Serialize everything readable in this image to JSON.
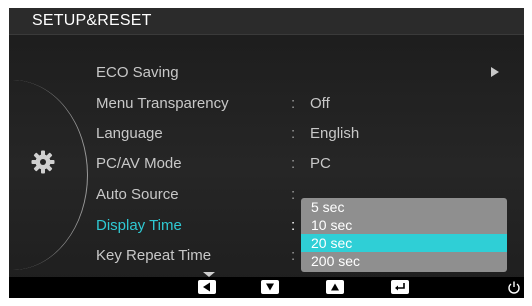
{
  "title": "SETUP&RESET",
  "menu": [
    {
      "label": "ECO Saving",
      "value": "",
      "has_colon": false,
      "submenu_arrow": true
    },
    {
      "label": "Menu Transparency",
      "value": "Off",
      "has_colon": true
    },
    {
      "label": "Language",
      "value": "English",
      "has_colon": true
    },
    {
      "label": "PC/AV Mode",
      "value": "PC",
      "has_colon": true
    },
    {
      "label": "Auto Source",
      "value": "",
      "has_colon": true
    },
    {
      "label": "Display Time",
      "value": "",
      "has_colon": true,
      "active": true
    },
    {
      "label": "Key Repeat Time",
      "value": "",
      "has_colon": true
    }
  ],
  "colon": ":",
  "dropdown": {
    "options": [
      "5 sec",
      "10 sec",
      "20 sec",
      "200 sec"
    ],
    "selected": "20 sec"
  },
  "bottom_keys": [
    "left-key",
    "down-key",
    "up-key",
    "enter-key",
    "power-key"
  ],
  "colors": {
    "active_text": "#2fc9d3",
    "selection": "#2fcfd6",
    "dropdown_bg": "#8f8f8f"
  }
}
